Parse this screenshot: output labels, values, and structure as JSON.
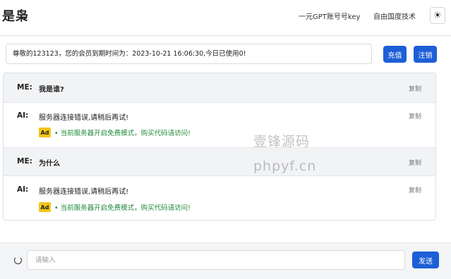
{
  "header": {
    "logo": "是枭",
    "nav": [
      "一元GPT账号号key",
      "自由国度技术"
    ],
    "theme_icon": "☀"
  },
  "status": {
    "text": "尊敬的123123，您的会员到期时间为：2023-10-21 16:06:30,今日已使用0!",
    "recharge_label": "充值",
    "logout_label": "注销"
  },
  "messages": [
    {
      "role": "ME:",
      "text": "我是谁?",
      "copy": "复制"
    },
    {
      "role": "AI:",
      "text": "服务器连接错误,请稍后再试!",
      "copy": "复制",
      "ad_badge": "Ad",
      "ad_text": "• 当前服务器开启免费模式，购买代码请访问!"
    },
    {
      "role": "ME:",
      "text": "为什么",
      "copy": "复制"
    },
    {
      "role": "AI:",
      "text": "服务器连接错误,请稍后再试!",
      "copy": "复制",
      "ad_badge": "Ad",
      "ad_text": "• 当前服务器开启免费模式，购买代码请访问!"
    }
  ],
  "watermark": [
    "壹锋源码",
    "phpyf.cn"
  ],
  "footer": {
    "input_placeholder": "请输入",
    "send_label": "发送"
  },
  "colors": {
    "primary": "#1d5fd6",
    "ad_badge": "#f5c518",
    "ad_text": "#1f8a3a",
    "user_row_bg": "#f2f3f5"
  }
}
